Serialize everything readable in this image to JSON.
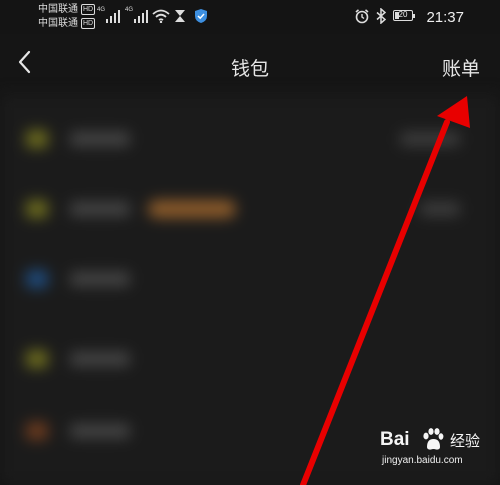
{
  "status_bar": {
    "carrier_1": "中国联通",
    "carrier_2": "中国联通",
    "hd_badge": "HD",
    "network_tag": "4G",
    "battery_level": "20",
    "time": "21:37",
    "icons": [
      "signal-icon",
      "signal-icon",
      "wifi-icon",
      "hourglass-icon",
      "shield-icon",
      "alarm-icon",
      "bluetooth-icon",
      "battery-icon"
    ]
  },
  "header": {
    "title": "钱包",
    "bill_label": "账单",
    "back_icon": "back-chevron-icon"
  },
  "colors": {
    "background": "#141414",
    "list_background": "#1b1b1b",
    "annotation_arrow": "#e80000",
    "badge": "#8a5a2a"
  },
  "watermark": {
    "logo_text": "Bai",
    "cn_text": "经验",
    "url": "jingyan.baidu.com"
  }
}
